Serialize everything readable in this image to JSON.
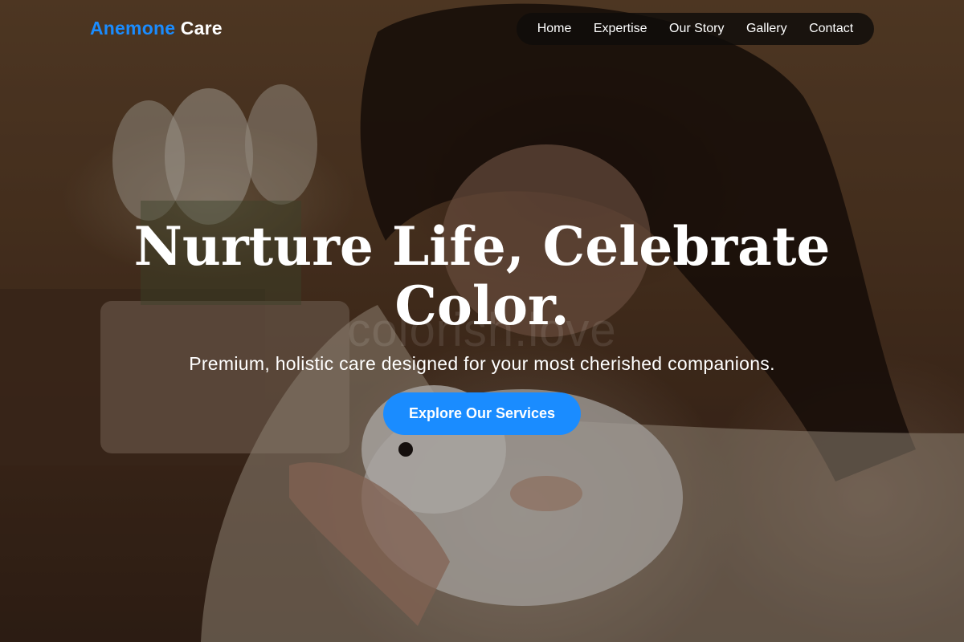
{
  "brand": {
    "name_part1": "Anemone",
    "name_part2": "Care",
    "accent_color": "#1a8cff"
  },
  "nav": {
    "items": [
      {
        "label": "Home"
      },
      {
        "label": "Expertise"
      },
      {
        "label": "Our Story"
      },
      {
        "label": "Gallery"
      },
      {
        "label": "Contact"
      }
    ]
  },
  "hero": {
    "headline": "Nurture Life, Celebrate Color.",
    "subtitle": "Premium, holistic care designed for your most cherished companions.",
    "cta_label": "Explore Our Services",
    "watermark": "colorish.love",
    "background_description": "photo-background"
  }
}
